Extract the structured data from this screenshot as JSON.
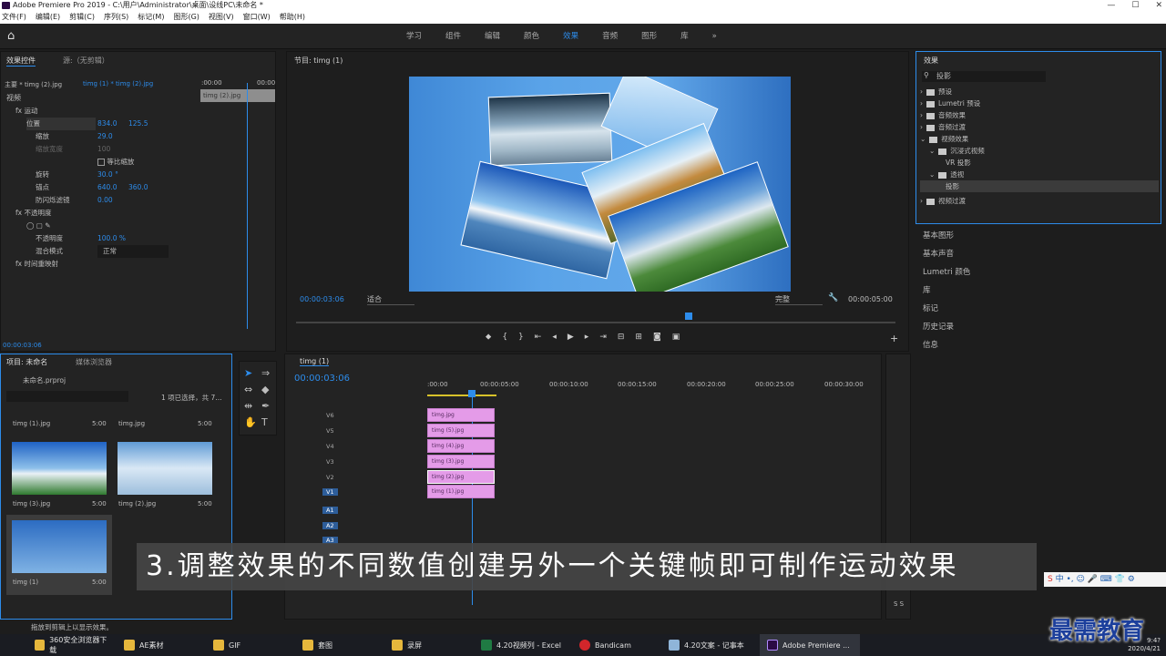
{
  "window": {
    "title": "Adobe Premiere Pro 2019 - C:\\用户\\Administrator\\桌面\\设线PC\\未命名 *",
    "controls": [
      "—",
      "☐",
      "✕"
    ]
  },
  "menu": [
    "文件(F)",
    "编辑(E)",
    "剪辑(C)",
    "序列(S)",
    "标记(M)",
    "图形(G)",
    "视图(V)",
    "窗口(W)",
    "帮助(H)"
  ],
  "workspaces": [
    "学习",
    "组件",
    "编辑",
    "颜色",
    "效果",
    "音频",
    "图形",
    "库"
  ],
  "workspace_active": "效果",
  "effect_controls": {
    "tab": "效果控件",
    "tab2": "源:（无剪辑）",
    "master": "主要 * timg (2).jpg",
    "clip": "timg (1) * timg (2).jpg",
    "tc_start": ":00:00",
    "tc_end": "00:00",
    "clip_label": "timg (2).jpg",
    "section_video": "视频",
    "motion": "运动",
    "position": "位置",
    "pos_x": "834.0",
    "pos_y": "125.5",
    "scale": "缩放",
    "scale_v": "29.0",
    "scale_w": "缩放宽度",
    "scale_w_v": "100",
    "uniform": "等比缩放",
    "rotation": "旋转",
    "rotation_v": "30.0 °",
    "anchor": "锚点",
    "anchor_x": "640.0",
    "anchor_y": "360.0",
    "antiflicker": "防闪烁滤镜",
    "antiflicker_v": "0.00",
    "opacity": "不透明度",
    "opacity_row": "不透明度",
    "opacity_v": "100.0 %",
    "blend": "混合模式",
    "blend_v": "正常",
    "time_remap": "时间重映射",
    "timecode": "00:00:03:06"
  },
  "program": {
    "tab": "节目: timg (1)",
    "timecode": "00:00:03:06",
    "fit": "适合",
    "quality": "完整",
    "duration": "00:00:05:00"
  },
  "effects_panel": {
    "title": "效果",
    "search": "投影",
    "items": [
      {
        "label": "预设"
      },
      {
        "label": "Lumetri 预设"
      },
      {
        "label": "音频效果"
      },
      {
        "label": "音频过渡"
      },
      {
        "label": "视频效果"
      },
      {
        "label": "沉浸式视频"
      },
      {
        "label": "VR 投影"
      },
      {
        "label": "透视"
      },
      {
        "label": "投影"
      },
      {
        "label": "视频过渡"
      }
    ]
  },
  "right_panels": [
    "基本图形",
    "基本声音",
    "Lumetri 颜色",
    "库",
    "标记",
    "历史记录",
    "信息"
  ],
  "project": {
    "tab": "项目: 未命名",
    "tab2": "媒体浏览器",
    "file": "未命名.prproj",
    "selection": "1 项已选择，共 7...",
    "items": [
      {
        "name": "timg (1).jpg",
        "dur": "5:00"
      },
      {
        "name": "timg.jpg",
        "dur": "5:00"
      },
      {
        "name": "timg (3).jpg",
        "dur": "5:00"
      },
      {
        "name": "timg (2).jpg",
        "dur": "5:00"
      },
      {
        "name": "timg (1)",
        "dur": "5:00"
      }
    ]
  },
  "timeline": {
    "tab": "timg (1)",
    "timecode": "00:00:03:06",
    "ruler": [
      ":00:00",
      "00:00:05:00",
      "00:00:10:00",
      "00:00:15:00",
      "00:00:20:00",
      "00:00:25:00",
      "00:00:30:00"
    ],
    "video_tracks": [
      "V6",
      "V5",
      "V4",
      "V3",
      "V2",
      "V1"
    ],
    "audio_tracks": [
      "A1",
      "A2",
      "A3"
    ],
    "clips": [
      "timg.jpg",
      "timg (5).jpg",
      "timg (4).jpg",
      "timg (3).jpg",
      "timg (2).jpg",
      "timg (1).jpg"
    ]
  },
  "caption": "3.调整效果的不同数值创建另外一个关键帧即可制作运动效果",
  "status": "拖放到剪辑上以显示效果。",
  "meter": "S S",
  "ime_tray": "中 •, ☺ 🎤 ⌨ 👕 ⚙",
  "taskbar": {
    "items": [
      "360安全浏览器下载",
      "AE素材",
      "GIF",
      "套图",
      "录屏",
      "4.20视频列 - Excel",
      "Bandicam",
      "4.20文案 - 记事本",
      "Adobe Premiere ..."
    ],
    "time": "9:4?",
    "date": "2020/4/21"
  },
  "watermark": "最需教育"
}
